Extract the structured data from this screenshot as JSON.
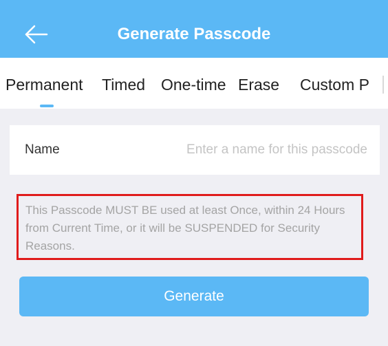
{
  "header": {
    "title": "Generate Passcode",
    "back_icon": "arrow-left-icon"
  },
  "tabs": [
    {
      "label": "Permanent",
      "active": true
    },
    {
      "label": "Timed",
      "active": false
    },
    {
      "label": "One-time",
      "active": false
    },
    {
      "label": "Erase",
      "active": false
    },
    {
      "label": "Custom P",
      "active": false
    }
  ],
  "form": {
    "name_label": "Name",
    "name_placeholder": "Enter a name for this passcode",
    "name_value": ""
  },
  "notice": {
    "text": "This Passcode MUST BE used at least Once, within 24 Hours from Current Time, or it will be SUSPENDED for Security Reasons."
  },
  "generate_button": {
    "label": "Generate"
  },
  "colors": {
    "accent": "#5bb8f5",
    "background": "#efeff4",
    "notice_border": "#e01b1b",
    "notice_text": "#a4a4a4"
  }
}
